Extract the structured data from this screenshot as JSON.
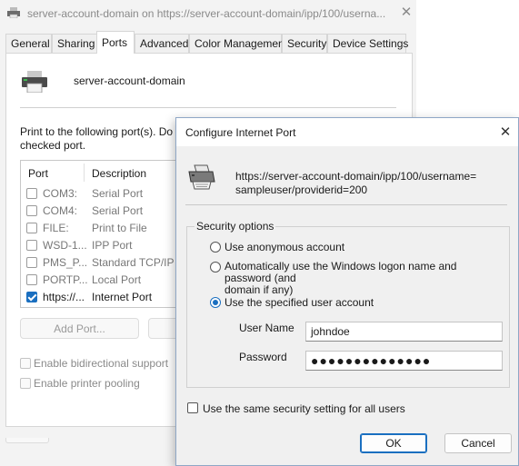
{
  "window": {
    "title": "server-account-domain on https://server-account-domain/ipp/100/userna...",
    "close_glyph": "✕"
  },
  "tabs": [
    {
      "label": "General"
    },
    {
      "label": "Sharing"
    },
    {
      "label": "Ports",
      "active": true
    },
    {
      "label": "Advanced"
    },
    {
      "label": "Color Management"
    },
    {
      "label": "Security"
    },
    {
      "label": "Device Settings"
    }
  ],
  "ports_page": {
    "printer_name": "server-account-domain",
    "description": "Print to the following port(s). Do checked port.",
    "description_line1": "Print to the following port(s). Do",
    "description_line2": "checked port.",
    "columns": {
      "port": "Port",
      "description": "Description"
    },
    "rows": [
      {
        "port": "COM3:",
        "description": "Serial Port",
        "checked": false
      },
      {
        "port": "COM4:",
        "description": "Serial Port",
        "checked": false
      },
      {
        "port": "FILE:",
        "description": "Print to File",
        "checked": false
      },
      {
        "port": "WSD-1...",
        "description": "IPP Port",
        "checked": false
      },
      {
        "port": "PMS_P...",
        "description": "Standard TCP/IP P",
        "checked": false
      },
      {
        "port": "PORTP...",
        "description": "Local Port",
        "checked": false
      },
      {
        "port": "https://...",
        "description": "Internet Port",
        "checked": true
      }
    ],
    "add_port_label": "Add Port...",
    "bidirectional_label": "Enable bidirectional support",
    "pooling_label": "Enable printer pooling"
  },
  "dialog": {
    "title": "Configure Internet Port",
    "close_glyph": "✕",
    "url_line1": "https://server-account-domain/ipp/100/username=",
    "url_line2": "sampleuser/providerid=200",
    "group_label": "Security options",
    "option_anonymous": "Use anonymous account",
    "option_windows_line1": "Automatically use the Windows logon name and password (and",
    "option_windows_line2": "domain if any)",
    "option_specified": "Use the specified user account",
    "selected_option": "specified",
    "username_label": "User Name",
    "username_value": "johndoe",
    "password_label": "Password",
    "password_value": "●●●●●●●●●●●●●●",
    "same_setting_label": "Use the same security setting for all users",
    "same_setting_checked": false,
    "ok_label": "OK",
    "cancel_label": "Cancel"
  },
  "colors": {
    "accent": "#1a6fc0",
    "window_bg": "#f3f3f3",
    "dialog_bg": "#f0f0f0"
  },
  "icons": [
    "printer-icon",
    "close-icon",
    "internet-printer-icon"
  ]
}
